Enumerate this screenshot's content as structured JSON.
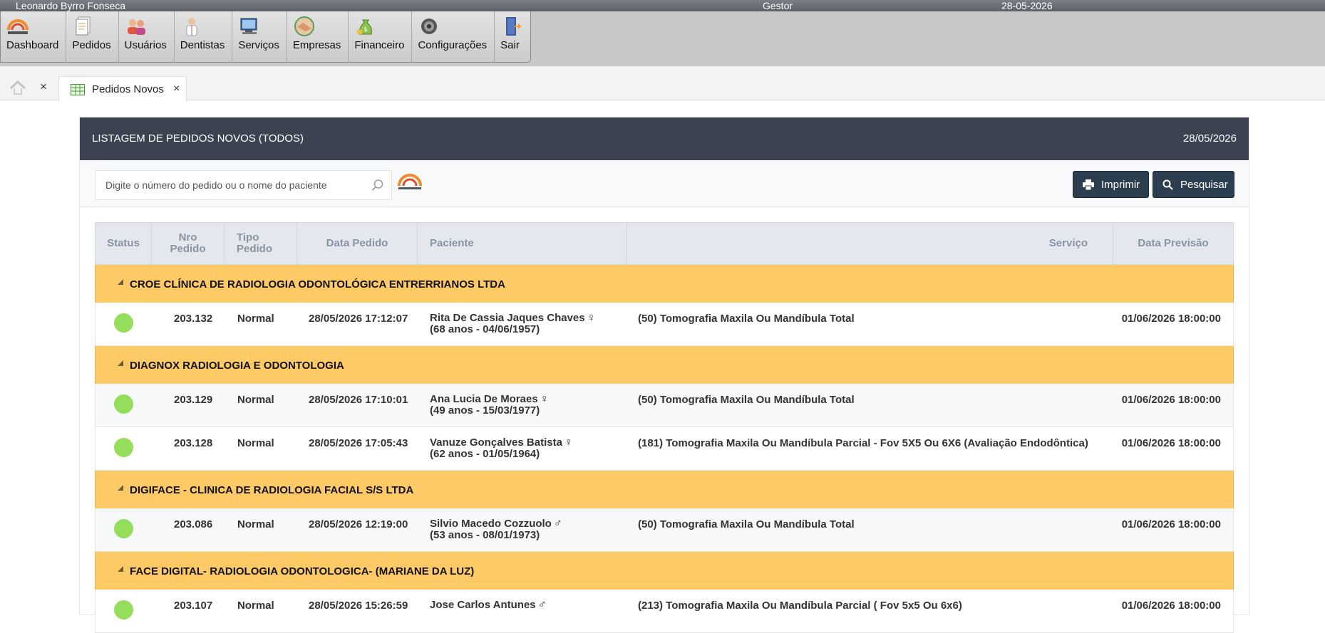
{
  "topbar": {
    "user": "Leonardo Byrro Fonseca",
    "role": "Gestor",
    "date": "28-05-2026"
  },
  "menu": [
    {
      "label": "Dashboard",
      "icon": "diagnosis-logo-icon"
    },
    {
      "label": "Pedidos",
      "icon": "documents-icon"
    },
    {
      "label": "Usuários",
      "icon": "users-icon"
    },
    {
      "label": "Dentistas",
      "icon": "dentist-icon"
    },
    {
      "label": "Serviços",
      "icon": "services-icon"
    },
    {
      "label": "Empresas",
      "icon": "handshake-icon"
    },
    {
      "label": "Financeiro",
      "icon": "money-bag-icon"
    },
    {
      "label": "Configurações",
      "icon": "gear-icon"
    },
    {
      "label": "Sair",
      "icon": "exit-door-icon"
    }
  ],
  "tabs": {
    "close": "×",
    "active_label": "Pedidos Novos"
  },
  "panel": {
    "title": "LISTAGEM DE PEDIDOS NOVOS (TODOS)",
    "date": "28/05/2026"
  },
  "search": {
    "placeholder": "Digite o número do pedido ou o nome do paciente"
  },
  "buttons": {
    "print": "Imprimir",
    "search": "Pesquisar"
  },
  "columns": {
    "status": "Status",
    "nro_1": "Nro",
    "nro_2": "Pedido",
    "tipo_1": "Tipo",
    "tipo_2": "Pedido",
    "data": "Data Pedido",
    "paciente": "Paciente",
    "servico": "Serviço",
    "previsao": "Data Previsão"
  },
  "colors": {
    "header": "#3b4351",
    "group": "#fdca66",
    "status_ok": "#95de5b",
    "button": "#2c3e50"
  },
  "groups": [
    {
      "name": "CROE CLÍNICA DE RADIOLOGIA ODONTOLÓGICA ENTRERRIANOS LTDA",
      "rows": [
        {
          "nro": "203.132",
          "tipo": "Normal",
          "data": "28/05/2026 17:12:07",
          "paciente": "Rita De Cassia Jaques Chaves",
          "sexo": "♀",
          "idade": "(68 anos - 04/06/1957)",
          "servico": "(50) Tomografia Maxila Ou Mandíbula Total",
          "previsao": "01/06/2026 18:00:00"
        }
      ]
    },
    {
      "name": "DIAGNOX RADIOLOGIA E ODONTOLOGIA",
      "rows": [
        {
          "nro": "203.129",
          "tipo": "Normal",
          "data": "28/05/2026 17:10:01",
          "paciente": "Ana Lucia De Moraes",
          "sexo": "♀",
          "idade": "(49 anos - 15/03/1977)",
          "servico": "(50) Tomografia Maxila Ou Mandíbula Total",
          "previsao": "01/06/2026 18:00:00"
        },
        {
          "nro": "203.128",
          "tipo": "Normal",
          "data": "28/05/2026 17:05:43",
          "paciente": "Vanuze Gonçalves Batista",
          "sexo": "♀",
          "idade": "(62 anos - 01/05/1964)",
          "servico": "(181) Tomografia Maxila Ou Mandíbula Parcial - Fov 5X5 Ou 6X6 (Avaliação Endodôntica)",
          "previsao": "01/06/2026 18:00:00"
        }
      ]
    },
    {
      "name": "DIGIFACE - CLINICA DE RADIOLOGIA FACIAL S/S LTDA",
      "rows": [
        {
          "nro": "203.086",
          "tipo": "Normal",
          "data": "28/05/2026 12:19:00",
          "paciente": "Silvio Macedo Cozzuolo",
          "sexo": "♂",
          "idade": "(53 anos - 08/01/1973)",
          "servico": "(50) Tomografia Maxila Ou Mandíbula Total",
          "previsao": "01/06/2026 18:00:00"
        }
      ]
    },
    {
      "name": "FACE DIGITAL- RADIOLOGIA ODONTOLOGICA- (MARIANE DA LUZ)",
      "rows": [
        {
          "nro": "203.107",
          "tipo": "Normal",
          "data": "28/05/2026 15:26:59",
          "paciente": "Jose Carlos Antunes",
          "sexo": "♂",
          "idade": "",
          "servico": "(213) Tomografia Maxila Ou Mandíbula Parcial ( Fov 5x5 Ou 6x6)",
          "previsao": "01/06/2026 18:00:00"
        }
      ]
    }
  ]
}
